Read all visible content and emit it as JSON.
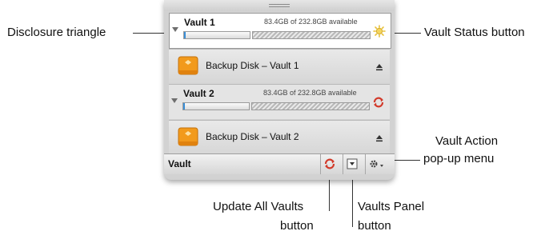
{
  "callouts": {
    "disclosure_triangle": "Disclosure triangle",
    "vault_status_button": "Vault Status button",
    "vault_action_menu_line1": "Vault Action",
    "vault_action_menu_line2": "pop-up menu",
    "update_all_vaults_line1": "Update All Vaults",
    "update_all_vaults_line2": "button",
    "vaults_panel_line1": "Vaults Panel",
    "vaults_panel_line2": "button"
  },
  "vaults": [
    {
      "name": "Vault 1",
      "availability": "83.4GB of 232.8GB available",
      "disk_name": "Backup Disk – Vault 1",
      "status_icon": "sun-icon",
      "status_color": "#e8c23a"
    },
    {
      "name": "Vault 2",
      "availability": "83.4GB of 232.8GB available",
      "disk_name": "Backup Disk – Vault 2",
      "status_icon": "refresh-icon",
      "status_color": "#d23a2a"
    }
  ],
  "bottom_bar": {
    "label": "Vault",
    "buttons": [
      "refresh-icon",
      "panel-icon",
      "gear-menu-icon"
    ]
  },
  "colors": {
    "disk_icon": "#f29a1c",
    "refresh": "#d23a2a"
  }
}
